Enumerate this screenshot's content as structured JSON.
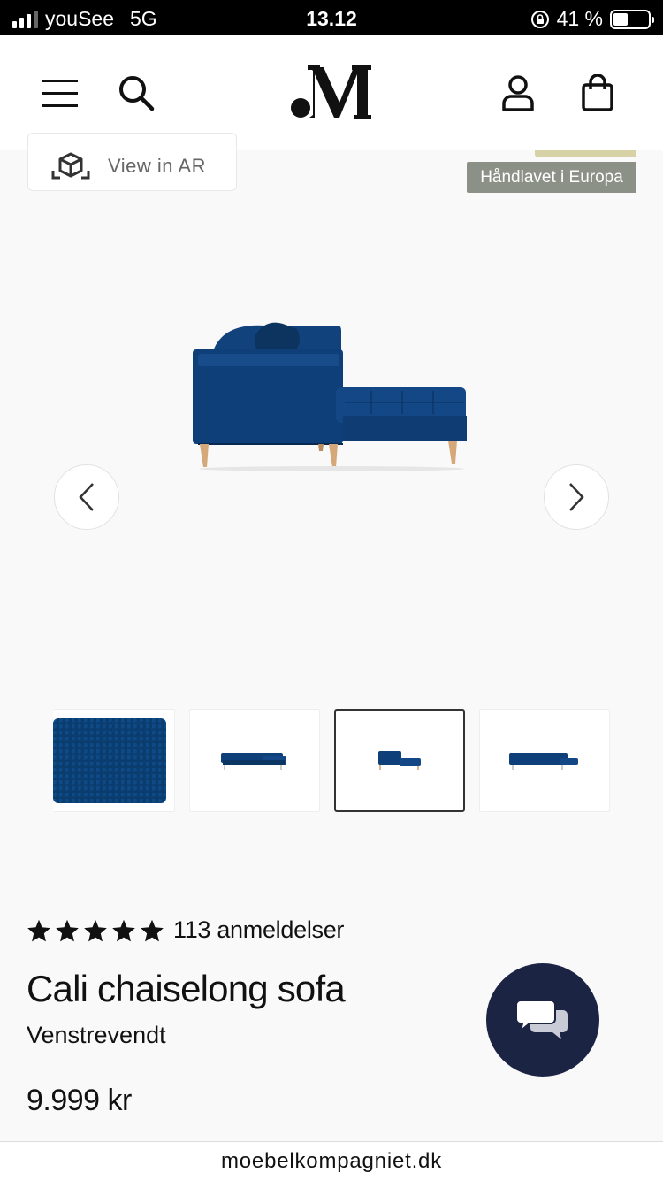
{
  "status_bar": {
    "carrier": "youSee",
    "network": "5G",
    "time": "13.12",
    "battery_percent": "41 %",
    "battery_level": 0.41
  },
  "header": {
    "logo_text": ".M",
    "icons": [
      "menu-icon",
      "search-icon",
      "account-icon",
      "bag-icon"
    ]
  },
  "gallery": {
    "ar_button_label": "View in AR",
    "badge_label": "Håndlavet i Europa",
    "thumbnails": [
      "fabric-swatch",
      "sofa-front-view",
      "sofa-side-view",
      "sofa-back-view"
    ],
    "active_thumbnail": 2
  },
  "product": {
    "stars": 5,
    "reviews_label": "113 anmeldelser",
    "name": "Cali chaiselong sofa",
    "variant": "Venstrevendt",
    "price": "9.999 kr"
  },
  "browser": {
    "url": "moebelkompagniet.dk"
  },
  "colors": {
    "sofa_blue": "#0f3f78",
    "badge_gray": "#8c9188",
    "chat_navy": "#1c2444"
  }
}
